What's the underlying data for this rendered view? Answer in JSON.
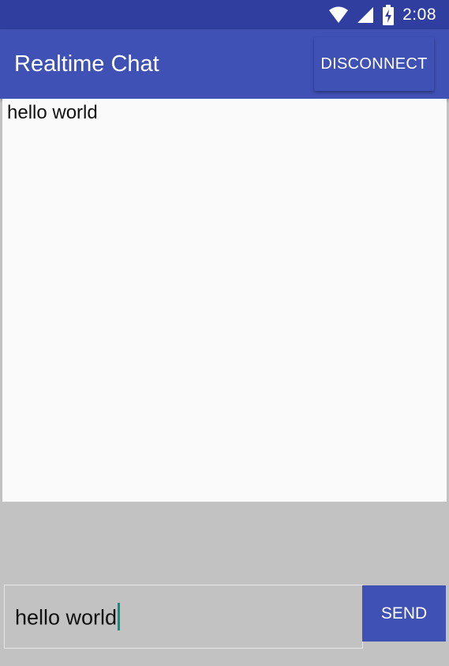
{
  "status_bar": {
    "time": "2:08",
    "icons": [
      "wifi-icon",
      "cell-signal-icon",
      "battery-charging-icon"
    ]
  },
  "app_bar": {
    "title": "Realtime Chat",
    "disconnect_label": "DISCONNECT"
  },
  "messages": {
    "items": [
      "hello world"
    ]
  },
  "composer": {
    "input_value": "hello world",
    "send_label": "SEND"
  },
  "colors": {
    "status_bar": "#303f9f",
    "primary": "#3f51b5",
    "accent": "#009688",
    "background": "#fafafa",
    "composer_background": "#c2c2c2"
  }
}
